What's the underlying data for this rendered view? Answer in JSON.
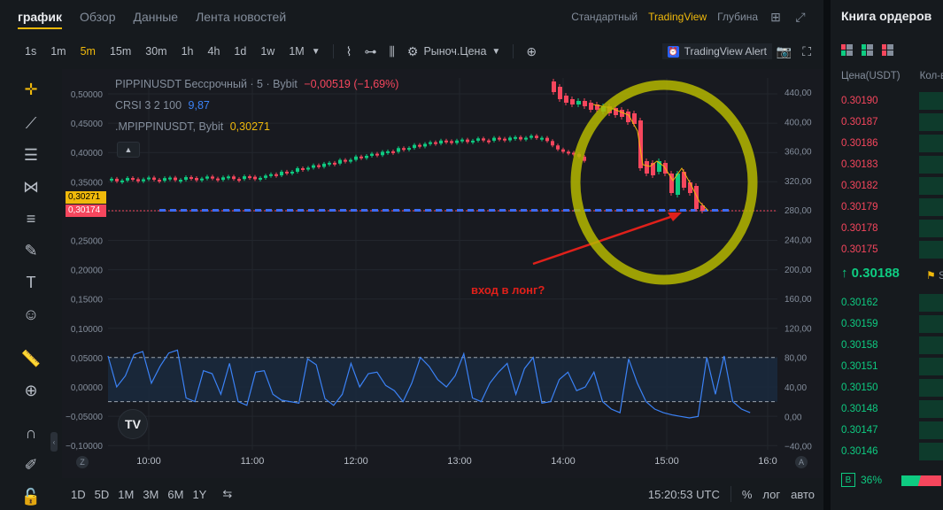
{
  "tabs": [
    {
      "label": "график",
      "active": true
    },
    {
      "label": "Обзор",
      "active": false
    },
    {
      "label": "Данные",
      "active": false
    },
    {
      "label": "Лента новостей",
      "active": false
    }
  ],
  "view_modes": {
    "standard": "Стандартный",
    "tradingview": "TradingView",
    "depth": "Глубина"
  },
  "timeframes": [
    "1s",
    "1m",
    "5m",
    "15m",
    "30m",
    "1h",
    "4h",
    "1d",
    "1w",
    "1M"
  ],
  "active_timeframe": "5m",
  "price_type": "Рыноч.Цена",
  "tv_alert": "TradingView Alert",
  "legend": {
    "symbol_line": "PIPPINUSDT Бессрочный · 5 · Bybit",
    "change": "−0,00519 (−1,69%)",
    "crsi_label": "CRSI 3 2 100",
    "crsi_value": "9,87",
    "mp_label": ".MPIPPINUSDT, Bybit",
    "mp_value": "0,30271"
  },
  "price_tags": {
    "mark": "0,30271",
    "last": "0,30174"
  },
  "left_axis": [
    "0,50000",
    "0,45000",
    "0,40000",
    "0,35000",
    "0,30000",
    "0,25000",
    "0,20000",
    "0,15000",
    "0,10000",
    "0,05000",
    "0,00000",
    "−0,05000",
    "−0,10000"
  ],
  "right_axis": [
    "440,00",
    "400,00",
    "360,00",
    "320,00",
    "280,00",
    "240,00",
    "200,00",
    "160,00",
    "120,00",
    "80,00",
    "40,00",
    "0,00",
    "−40,00"
  ],
  "time_axis": [
    "10:00",
    "11:00",
    "12:00",
    "13:00",
    "14:00",
    "15:00",
    "16:0"
  ],
  "axis_buttons": {
    "left": "Z",
    "right": "A"
  },
  "annotation": "вход в лонг?",
  "bottom": {
    "ranges": [
      "1D",
      "5D",
      "1M",
      "3M",
      "6M",
      "1Y"
    ],
    "clock": "15:20:53 UTC",
    "percent": "%",
    "log": "лог",
    "auto": "авто"
  },
  "orderbook": {
    "title": "Книга ордеров",
    "col_price": "Цена(USDT)",
    "col_qty": "Кол-в",
    "asks": [
      "0.30190",
      "0.30187",
      "0.30186",
      "0.30183",
      "0.30182",
      "0.30179",
      "0.30178",
      "0.30175"
    ],
    "mid": "↑ 0.30188",
    "bids": [
      "0.30162",
      "0.30159",
      "0.30158",
      "0.30151",
      "0.30150",
      "0.30148",
      "0.30147",
      "0.30146"
    ],
    "ratio_label": "B",
    "ratio_value": "36%"
  },
  "colors": {
    "up": "#0ecb81",
    "down": "#f6465d",
    "accent": "#f0b90b",
    "crsi": "#3b82f6",
    "highlight": "#b5b800"
  }
}
